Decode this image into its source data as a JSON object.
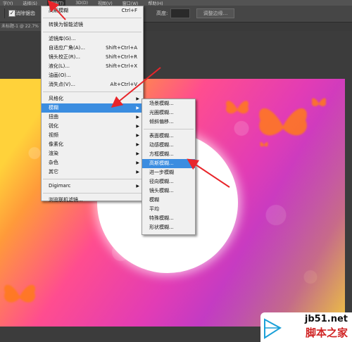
{
  "menubar": {
    "items": [
      "字(Y)",
      "选择(S)",
      "滤镜(T)",
      "3D(D)",
      "视图(V)",
      "窗口(W)",
      "帮助(H)"
    ],
    "active_index": 2
  },
  "options_bar": {
    "checkbox_label": "消除锯齿",
    "checkbox_checked": true,
    "height_label": "高度:",
    "height_value": "",
    "adjust_button": "调整边缘..."
  },
  "document_tab": {
    "title": "未标题-1 @ 22.7%"
  },
  "filter_menu": {
    "items": [
      {
        "label": "高斯模糊",
        "shortcut": "Ctrl+F"
      },
      {
        "separator": true
      },
      {
        "label": "转换为智能滤镜"
      },
      {
        "separator": true
      },
      {
        "label": "滤镜库(G)..."
      },
      {
        "label": "自适应广角(A)...",
        "shortcut": "Shift+Ctrl+A"
      },
      {
        "label": "镜头校正(R)...",
        "shortcut": "Shift+Ctrl+R"
      },
      {
        "label": "液化(L)...",
        "shortcut": "Shift+Ctrl+X"
      },
      {
        "label": "油画(O)..."
      },
      {
        "label": "消失点(V)...",
        "shortcut": "Alt+Ctrl+V"
      },
      {
        "separator": true
      },
      {
        "label": "风格化",
        "submenu": true
      },
      {
        "label": "模糊",
        "submenu": true,
        "highlighted": true
      },
      {
        "label": "扭曲",
        "submenu": true
      },
      {
        "label": "锐化",
        "submenu": true
      },
      {
        "label": "视频",
        "submenu": true
      },
      {
        "label": "像素化",
        "submenu": true
      },
      {
        "label": "渲染",
        "submenu": true
      },
      {
        "label": "杂色",
        "submenu": true
      },
      {
        "label": "其它",
        "submenu": true
      },
      {
        "separator": true
      },
      {
        "label": "Digimarc",
        "submenu": true
      },
      {
        "separator": true
      },
      {
        "label": "浏览联机滤镜..."
      }
    ]
  },
  "blur_submenu": {
    "items": [
      {
        "label": "场景模糊..."
      },
      {
        "label": "光圈模糊..."
      },
      {
        "label": "倾斜偏移..."
      },
      {
        "separator": true
      },
      {
        "label": "表面模糊..."
      },
      {
        "label": "动感模糊..."
      },
      {
        "label": "方框模糊..."
      },
      {
        "label": "高斯模糊...",
        "highlighted": true
      },
      {
        "label": "进一步模糊"
      },
      {
        "label": "径向模糊..."
      },
      {
        "label": "镜头模糊..."
      },
      {
        "label": "模糊"
      },
      {
        "label": "平均"
      },
      {
        "label": "特殊模糊..."
      },
      {
        "label": "形状模糊..."
      }
    ]
  },
  "watermark": {
    "url": "jb51.net",
    "site_name": "脚本之家"
  },
  "colors": {
    "menu_highlight": "#3b8de0",
    "annotation_arrow": "#e8252a",
    "butterfly": "#ff7a1a"
  }
}
